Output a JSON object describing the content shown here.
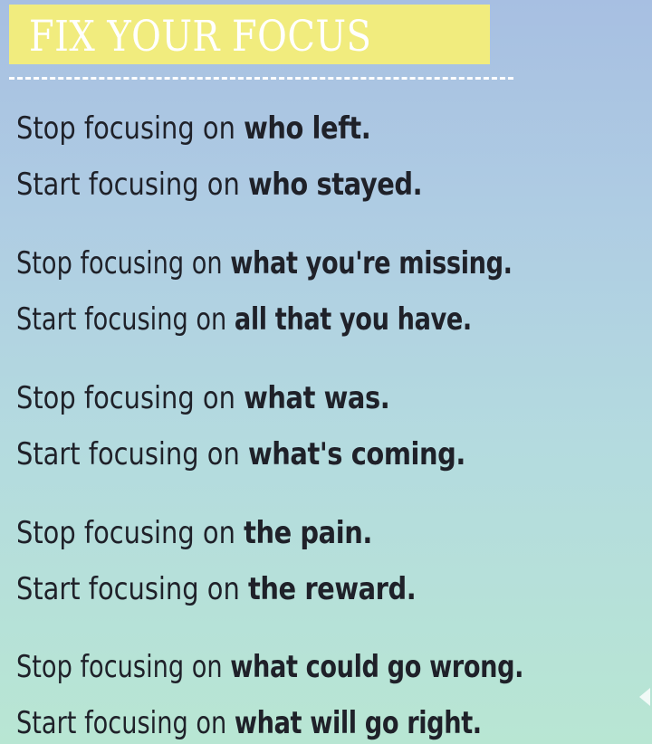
{
  "title": "FIX YOUR FOCUS",
  "pairs": [
    {
      "stop_prefix": "Stop focusing on ",
      "stop_emphasis": "who left.",
      "start_prefix": "Start focusing on ",
      "start_emphasis": "who stayed."
    },
    {
      "stop_prefix": "Stop focusing on ",
      "stop_emphasis": "what you're missing.",
      "start_prefix": "Start focusing on ",
      "start_emphasis": "all that you have."
    },
    {
      "stop_prefix": "Stop focusing on ",
      "stop_emphasis": "what was.",
      "start_prefix": "Start focusing on ",
      "start_emphasis": "what's coming."
    },
    {
      "stop_prefix": "Stop focusing on ",
      "stop_emphasis": "the pain.",
      "start_prefix": "Start focusing on ",
      "start_emphasis": "the reward."
    },
    {
      "stop_prefix": "Stop focusing on ",
      "stop_emphasis": "what could go wrong.",
      "start_prefix": "Start focusing on ",
      "start_emphasis": "what will go right."
    }
  ],
  "colors": {
    "title_highlight": "#f1ec7e",
    "title_text": "#ffffff",
    "body_text": "#1f2129",
    "gradient_top": "#a7bfe2",
    "gradient_bottom": "#b8e6d3"
  }
}
